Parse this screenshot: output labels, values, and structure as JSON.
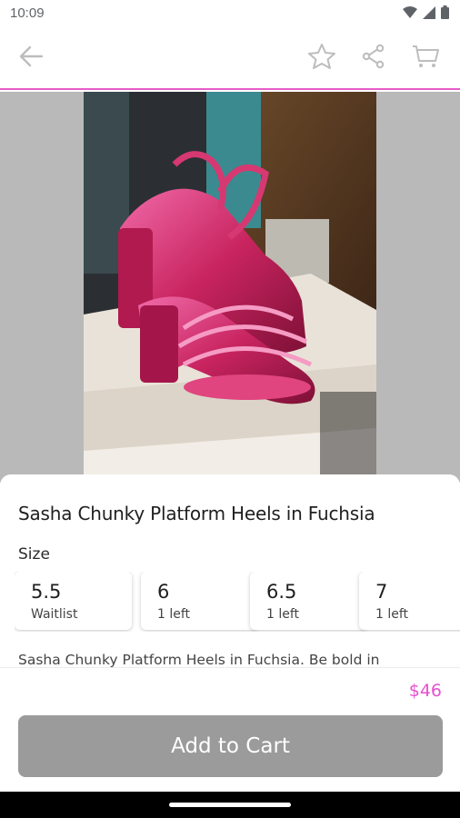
{
  "status": {
    "time": "10:09"
  },
  "toolbar": {
    "back_icon": "arrow-left-icon",
    "favorite_icon": "star-icon",
    "share_icon": "share-icon",
    "cart_icon": "cart-icon"
  },
  "product": {
    "title": "Sasha Chunky Platform Heels in Fuchsia",
    "size_label": "Size",
    "sizes": [
      {
        "size": "5.5",
        "availability": "Waitlist"
      },
      {
        "size": "6",
        "availability": "1 left"
      },
      {
        "size": "6.5",
        "availability": "1 left"
      },
      {
        "size": "7",
        "availability": "1 left"
      }
    ],
    "description": "Sasha Chunky Platform Heels in Fuchsia. Be bold in",
    "price": "$46"
  },
  "actions": {
    "add_to_cart": "Add to Cart"
  },
  "colors": {
    "accent": "#e84fd0",
    "button": "#9b9b9b",
    "hero_bg": "#b9b9b9"
  }
}
